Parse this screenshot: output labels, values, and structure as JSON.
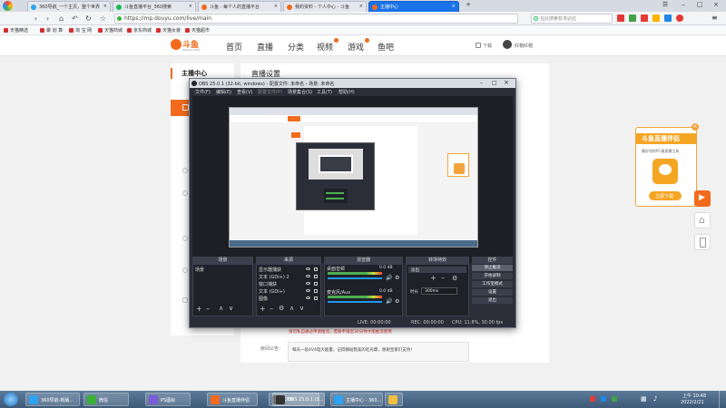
{
  "browser": {
    "tabs": [
      {
        "label": "360导航_一个主页，整个世界",
        "color": "#2ea3f2"
      },
      {
        "label": "斗鱼直播平台_360搜索",
        "color": "#19b955"
      },
      {
        "label": "斗鱼 - 每个人的直播平台",
        "color": "#f26b1d"
      },
      {
        "label": "我的资料 - 个人中心 - 斗鱼",
        "color": "#f26b1d"
      },
      {
        "label": "主播中心",
        "color": "#f26b1d"
      }
    ],
    "url": "https://mp.douyu.com/live/main",
    "search_placeholder": "在此搜索有求必应",
    "bookmarks": [
      "天猫精选",
      "聚 划 算",
      "淘 宝 网",
      "天猫商城",
      "京东商城",
      "天猫女装",
      "天猫超市"
    ]
  },
  "site": {
    "logo_text": "斗鱼",
    "logo_sub": "douyu.com",
    "nav": [
      "首页",
      "直播",
      "分类",
      "视频",
      "游戏",
      "鱼吧"
    ],
    "download_label": "下载",
    "username": "红帽红帽",
    "sidebar_title": "主播中心",
    "section_title": "直播设置",
    "warning_text": "请勿私自通过申请推流，需要申请后30分钟才能推流使用",
    "notice_label": "房间公告：",
    "notice_text": "每天一段4V4电大能量，记得摘斑我美的吃光摩，谢谢宝家们支持！"
  },
  "obs": {
    "title": "OBS 25.0.1 (32-bit, windows) - 配置文件: 未命名 - 场景: 未命名",
    "menu": [
      "文件(F)",
      "编辑(E)",
      "查看(V)",
      "配置文件(P)",
      "场景集合(S)",
      "工具(T)",
      "帮助(H)"
    ],
    "docks": {
      "scenes": "场景",
      "sources": "来源",
      "mixer": "混音器",
      "transitions": "转场特效",
      "controls": "控件"
    },
    "scene_items": [
      "场景"
    ],
    "source_items": [
      "显示器捕获",
      "文本 (GDI+) 2",
      "窗口捕获",
      "文本 (GDI+)",
      "图像"
    ],
    "mixer_channels": [
      {
        "name": "桌面音频",
        "db": "0.0 dB"
      },
      {
        "name": "麦克风/Aux",
        "db": "0.0 dB"
      }
    ],
    "transition": {
      "type": "淡出",
      "duration_label": "时长",
      "duration": "300ms"
    },
    "control_buttons": [
      "停止推流",
      "开始录制",
      "工作室模式",
      "设置",
      "退出"
    ],
    "status": {
      "live": "LIVE: 00:00:00",
      "rec": "REC: 00:00:00",
      "cpu": "CPU: 11.8%, 30.00 fps"
    }
  },
  "promo": {
    "title": "斗鱼直播伴侣",
    "subtitle": "最好用的PC端直播工具",
    "button": "立即下载"
  },
  "taskbar": {
    "items": [
      {
        "label": "360导航-新版...",
        "color": "#2ea3f2"
      },
      {
        "label": "微信",
        "color": "#3cb034"
      },
      {
        "label": "PS图标",
        "color": "#7b5cd6"
      },
      {
        "label": "斗鱼直播伴侣",
        "color": "#f26b1d"
      },
      {
        "label": "OBS",
        "color": "#333333"
      },
      {
        "label": "OBS 25.0.1 (3...",
        "color": "#333333"
      },
      {
        "label": "主播中心 - 360...",
        "color": "#2ea3f2"
      },
      {
        "label": "",
        "color": "#f0c040"
      }
    ],
    "clock_time": "上午 10:48",
    "clock_date": "2022/2/21"
  }
}
